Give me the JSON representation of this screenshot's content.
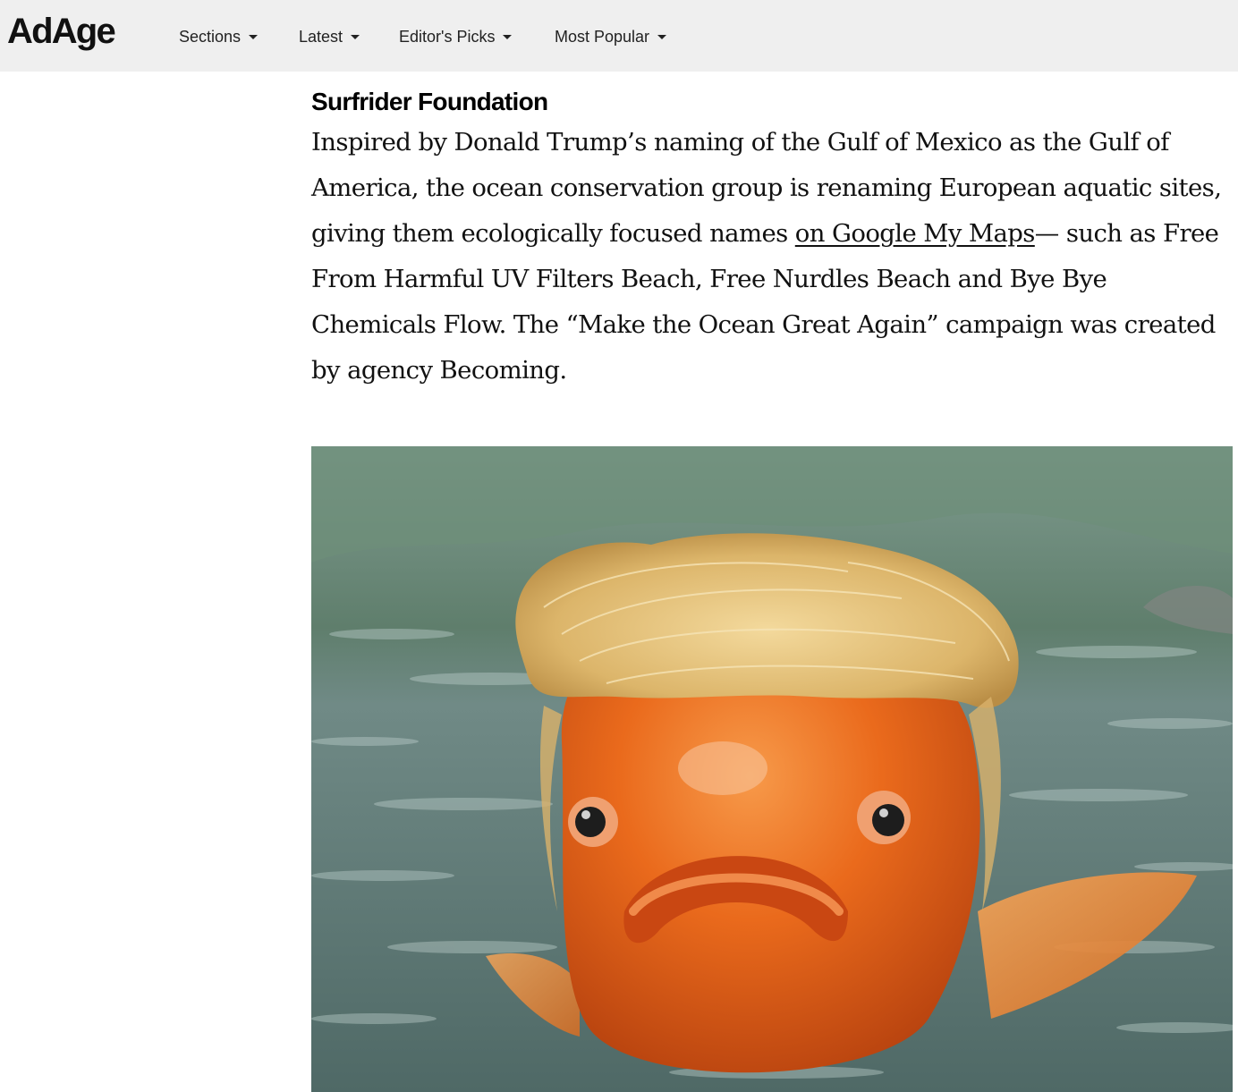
{
  "header": {
    "logo": "AdAge",
    "nav": [
      {
        "label": "Sections"
      },
      {
        "label": "Latest"
      },
      {
        "label": "Editor's Picks"
      },
      {
        "label": "Most Popular"
      }
    ]
  },
  "article": {
    "section_title": "Surfrider Foundation",
    "paragraph": {
      "before_link": "Inspired by Donald Trump’s naming of the Gulf of Mexico as the Gulf of America, the ocean conservation group is renaming European aquatic sites, giving them ecologically focused names ",
      "link_text": "on Google My Maps",
      "after_link": "— such as Free From Harmful UV Filters Beach, Free Nurdles Beach and Bye Bye Chemicals Flow. The “Make the Ocean Great Again” campaign was created by agency Becoming."
    }
  },
  "colors": {
    "header_bg": "#efefef",
    "fish_orange": "#e8631a",
    "water": "#5f7a78"
  }
}
